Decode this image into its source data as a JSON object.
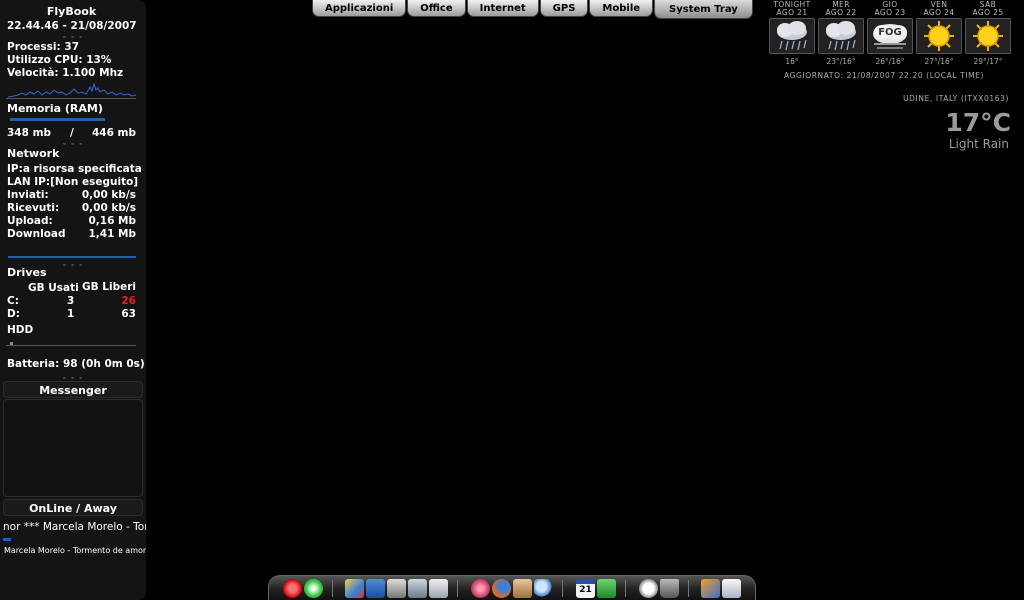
{
  "sidebar": {
    "title": "FlyBook",
    "datetime": "22.44.46 - 21/08/2007",
    "processes": "Processi: 37",
    "cpu_usage": "Utilizzo CPU: 13%",
    "cpu_speed": "Velocità: 1.100 Mhz",
    "memory": {
      "title": "Memoria (RAM)",
      "used": "348 mb",
      "separator": "/",
      "total": "446 mb"
    },
    "network": {
      "title": "Network",
      "rows": [
        {
          "label": "IP:",
          "value": "a risorsa specificata"
        },
        {
          "label": "LAN IP:",
          "value": "[Non eseguito]"
        },
        {
          "label": "Inviati:",
          "value": "0,00 kb/s"
        },
        {
          "label": "Ricevuti:",
          "value": "0,00 kb/s"
        },
        {
          "label": "Upload:",
          "value": "0,16 Mb"
        },
        {
          "label": "Download",
          "value": "1,41 Mb"
        }
      ]
    },
    "drives": {
      "title": "Drives",
      "col_used": "GB Usati",
      "col_free": "GB Liberi",
      "rows": [
        {
          "drive": "C:",
          "used": "3",
          "free": "26"
        },
        {
          "drive": "D:",
          "used": "1",
          "free": "63"
        }
      ],
      "hdd_label": "HDD",
      "free_alert_color": "#e02020"
    },
    "battery": "Batteria: 98 (0h 0m 0s)",
    "messenger": {
      "title": "Messenger",
      "status": "OnLine / Away",
      "now_playing_scroll": "nor *** Marcela Morelo - Tormento de amor",
      "now_playing": "Marcela Morelo - Tormento de amor"
    }
  },
  "tabs": [
    {
      "label": "Applicazioni",
      "active": false
    },
    {
      "label": "Office",
      "active": false
    },
    {
      "label": "Internet",
      "active": false
    },
    {
      "label": "GPS",
      "active": false
    },
    {
      "label": "Mobile",
      "active": false
    },
    {
      "label": "System Tray",
      "active": true
    }
  ],
  "weather": {
    "days": [
      {
        "name": "TONIGHT",
        "date": "AGO 21",
        "icon": "rain-icon",
        "temp": "16°"
      },
      {
        "name": "MER",
        "date": "AGO 22",
        "icon": "rain-icon",
        "temp": "23°/16°"
      },
      {
        "name": "GIO",
        "date": "AGO 23",
        "icon": "fog-icon",
        "temp": "26°/16°",
        "icon_text": "FOG"
      },
      {
        "name": "VEN",
        "date": "AGO 24",
        "icon": "sun-icon",
        "temp": "27°/16°"
      },
      {
        "name": "SAB",
        "date": "AGO 25",
        "icon": "sun-icon",
        "temp": "29°/17°"
      }
    ],
    "updated": "AGGIORNATO: 21/08/2007 22.20 (LOCAL TIME)",
    "location": "UDINE, ITALY (ITXX0163)",
    "current_temp": "17°C",
    "current_condition": "Light Rain"
  },
  "dock": {
    "icons": [
      "power-icon",
      "green-asterisk-icon",
      "paint-icon",
      "laptop-icon",
      "printer-icon",
      "scanner-icon",
      "notes-icon",
      "media-player-icon",
      "firefox-icon",
      "package-icon",
      "search-icon",
      "calendar-icon",
      "task-icon",
      "clock-icon",
      "trash-icon",
      "tools-icon",
      "mail-icon"
    ],
    "calendar_day": "21"
  },
  "colors": {
    "sidebar_bg": "#141414",
    "accent_blue": "#1e5fb0",
    "alert_red": "#e02020"
  }
}
